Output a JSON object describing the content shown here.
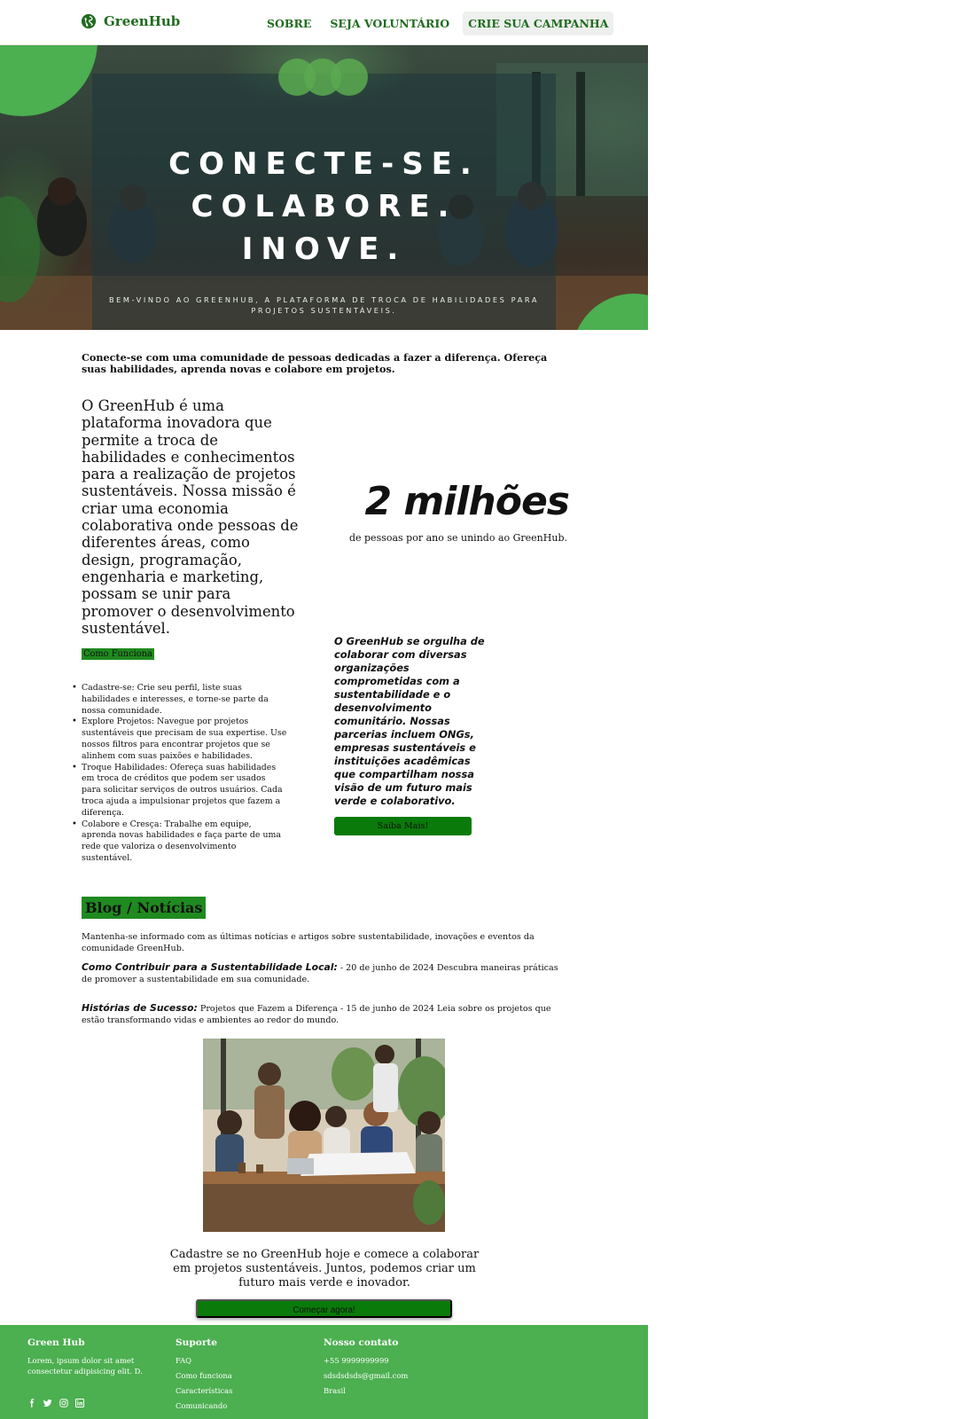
{
  "nav": {
    "brand": "GreenHub",
    "links": [
      "SOBRE",
      "SEJA VOLUNTÁRIO",
      "CRIE SUA CAMPANHA"
    ]
  },
  "hero": {
    "title_lines": [
      "CONECTE-SE.",
      "COLABORE.",
      "INOVE."
    ],
    "subtitle": "BEM-VINDO AO GREENHUB, A PLATAFORMA DE TROCA DE HABILIDADES PARA PROJETOS SUSTENTÁVEIS."
  },
  "intro": "Conecte-se com uma comunidade de pessoas dedicadas a fazer a diferença. Ofereça suas habilidades, aprenda novas e colabore em projetos.",
  "about": "O GreenHub é uma plataforma inovadora que permite a troca de habilidades e conhecimentos para a realização de projetos sustentáveis. Nossa missão é criar uma economia colaborativa onde pessoas de diferentes áreas, como design, programação, engenharia e marketing, possam se unir para promover o desenvolvimento sustentável.",
  "stat": {
    "value": "2 milhões",
    "caption": "de pessoas por ano se unindo ao GreenHub."
  },
  "how": {
    "badge": "Como Funciona",
    "steps": [
      "Cadastre-se: Crie seu perfil, liste suas habilidades e interesses, e torne-se parte da nossa comunidade.",
      "Explore Projetos: Navegue por projetos sustentáveis que precisam de sua expertise. Use nossos filtros para encontrar projetos que se alinhem com suas paixões e habilidades.",
      "Troque Habilidades: Ofereça suas habilidades em troca de créditos que podem ser usados para solicitar serviços de outros usuários. Cada troca ajuda a impulsionar projetos que fazem a diferença.",
      "Colabore e Cresça: Trabalhe em equipe, aprenda novas habilidades e faça parte de uma rede que valoriza o desenvolvimento sustentável."
    ]
  },
  "partners": {
    "text": "O GreenHub se orgulha de colaborar com diversas organizações comprometidas com a sustentabilidade e o desenvolvimento comunitário. Nossas parcerias incluem ONGs, empresas sustentáveis e instituições acadêmicas que compartilham nossa visão de um futuro mais verde e colaborativo.",
    "button": "Saiba Mais!"
  },
  "blog": {
    "title": "Blog / Notícias",
    "lead": "Mantenha-se informado com as últimas notícias e artigos sobre sustentabilidade, inovações e eventos da comunidade GreenHub.",
    "posts": [
      {
        "title": "Como Contribuir para a Sustentabilidade Local:",
        "body": " - 20 de junho de 2024 Descubra maneiras práticas de promover a sustentabilidade em sua comunidade."
      },
      {
        "title": "Histórias de Sucesso:",
        "body": " Projetos que Fazem a Diferença - 15 de junho de 2024 Leia sobre os projetos que estão transformando vidas e ambientes ao redor do mundo."
      }
    ]
  },
  "cta": {
    "text": "Cadastre  se no GreenHub hoje e comece a colaborar em projetos sustentáveis. Juntos, podemos criar um futuro mais verde e inovador.",
    "button": "Começar agora!"
  },
  "footer": {
    "col1": {
      "title": "Green Hub",
      "text": "Lorem, ipsum dolor sit amet consectetur adipisicing elit. D."
    },
    "col2": {
      "title": "Suporte",
      "links": [
        "FAQ",
        "Como funciona",
        "Características",
        "Comunicando"
      ]
    },
    "col3": {
      "title": "Nosso contato",
      "lines": [
        "+55 9999999999",
        "sdsdsdsds@gmail.com",
        "Brasil"
      ]
    },
    "socials": [
      "facebook-icon",
      "twitter-icon",
      "instagram-icon",
      "linkedin-icon"
    ]
  },
  "colors": {
    "brand_green": "#1f6b1f",
    "accent_green": "#4caf50",
    "button_green": "#0a7a0a"
  }
}
